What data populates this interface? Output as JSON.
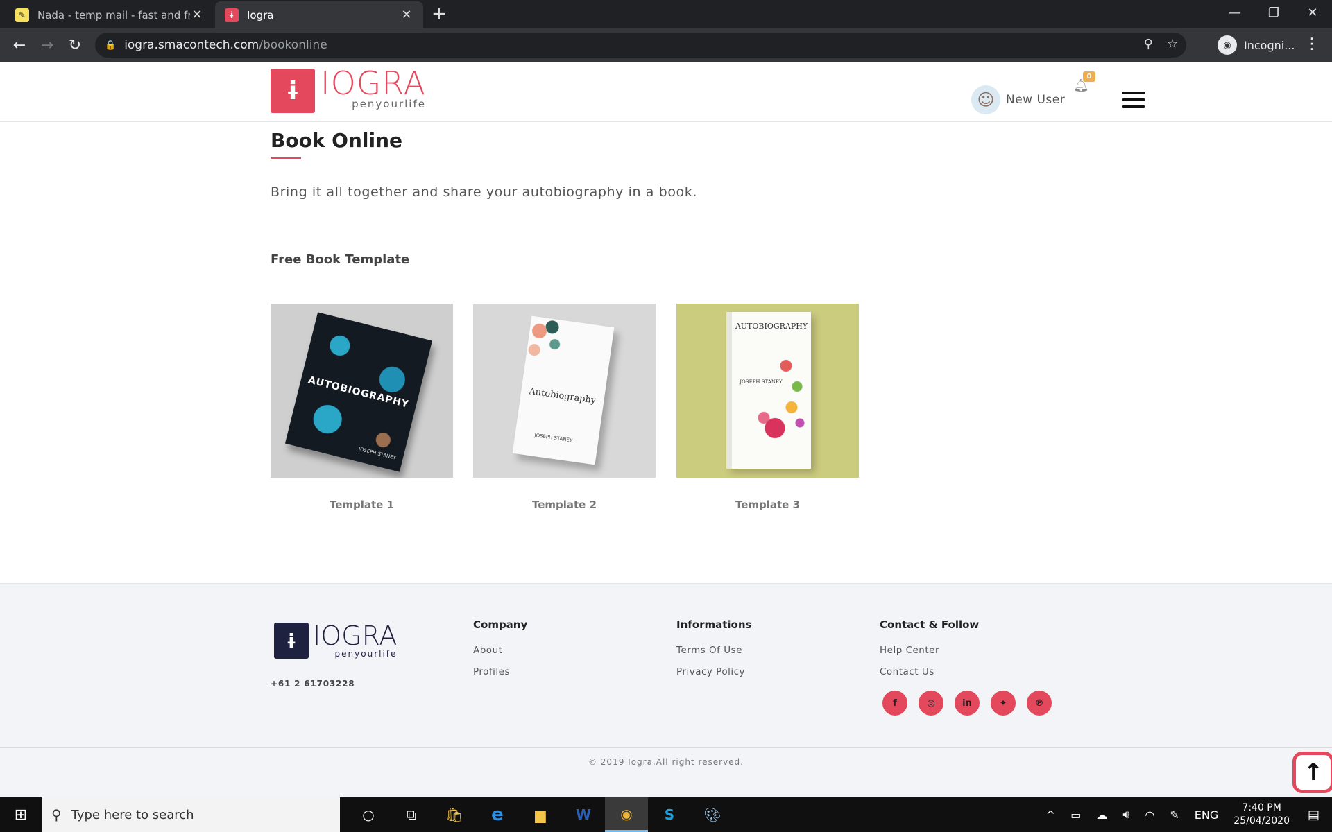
{
  "browser": {
    "tabs": [
      {
        "title": "Nada - temp mail - fast and free",
        "active": false,
        "favicon": "nada-icon"
      },
      {
        "title": "Iogra",
        "active": true,
        "favicon": "iogra-icon"
      }
    ],
    "url_host": "iogra.smacontech.com",
    "url_path": "/bookonline",
    "profile_label": "Incogni..."
  },
  "header": {
    "logo_word": "IOGRA",
    "logo_tagline": "penyourlife",
    "user_name": "New User",
    "notification_count": "0"
  },
  "main": {
    "title": "Book Online",
    "intro": "Bring it all together and share your autobiography in a book.",
    "section_heading": "Free Book Template",
    "templates": [
      {
        "caption": "Template 1",
        "cover_text": "AUTOBIOGRAPHY",
        "author": "JOSEPH STANEY",
        "bg": "#cfcfcf"
      },
      {
        "caption": "Template 2",
        "cover_text": "Autobiography",
        "author": "JOSEPH STANEY",
        "bg": "#d8d8d8"
      },
      {
        "caption": "Template 3",
        "cover_text": "AUTOBIOGRAPHY",
        "author": "JOSEPH STANEY",
        "bg": "#cccc7f"
      }
    ]
  },
  "footer": {
    "logo_word": "IOGRA",
    "logo_tagline": "penyourlife",
    "phone": "+61 2 61703228",
    "company_heading": "Company",
    "company_links": [
      "About",
      "Profiles"
    ],
    "info_heading": "Informations",
    "info_links": [
      "Terms Of Use",
      "Privacy Policy"
    ],
    "contact_heading": "Contact & Follow",
    "contact_links": [
      "Help Center",
      "Contact Us"
    ],
    "socials": [
      "facebook-icon",
      "instagram-icon",
      "linkedin-icon",
      "twitter-icon",
      "pinterest-icon"
    ],
    "copyright": "© 2019 Iogra.All right reserved."
  },
  "taskbar": {
    "search_placeholder": "Type here to search",
    "language": "ENG",
    "time": "7:40 PM",
    "date": "25/04/2020"
  },
  "colors": {
    "brand": "#e4485c",
    "footer_bg": "#f2f4f7",
    "badge": "#f0ad4e"
  }
}
